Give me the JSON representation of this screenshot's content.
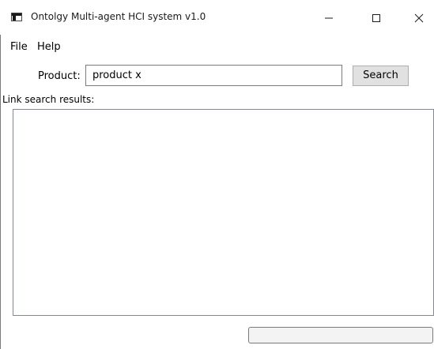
{
  "window": {
    "title": "Ontolgy Multi-agent HCI system v1.0"
  },
  "menu": {
    "items": [
      {
        "label": "File"
      },
      {
        "label": "Help"
      }
    ]
  },
  "product": {
    "label": "Product:",
    "value": "product x"
  },
  "search": {
    "button_label": "Search"
  },
  "results": {
    "label": "Link search results:",
    "items": []
  },
  "progress": {
    "value": 0
  },
  "icons": {
    "app": "app-window-icon",
    "minimize": "minimize-icon",
    "maximize": "maximize-icon",
    "close": "close-icon"
  }
}
